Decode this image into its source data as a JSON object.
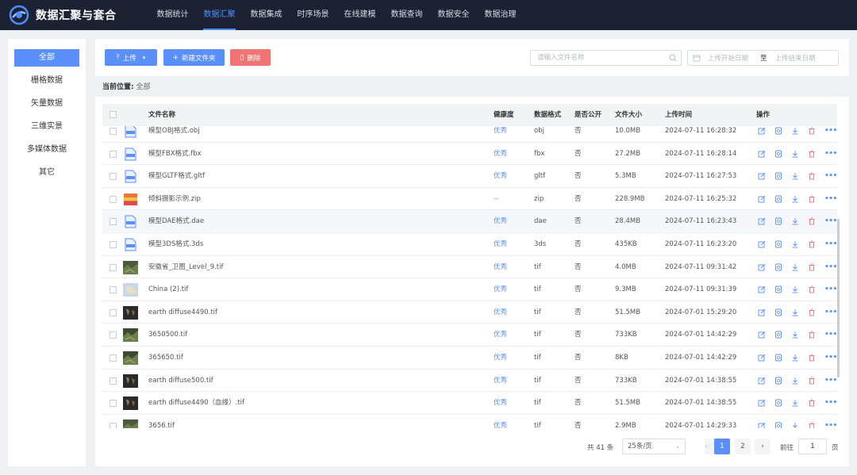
{
  "app": {
    "title": "数据汇聚与套合"
  },
  "nav": [
    {
      "label": "数据统计",
      "active": false
    },
    {
      "label": "数据汇聚",
      "active": true
    },
    {
      "label": "数据集成",
      "active": false
    },
    {
      "label": "时序场景",
      "active": false
    },
    {
      "label": "在线建模",
      "active": false
    },
    {
      "label": "数据查询",
      "active": false
    },
    {
      "label": "数据安全",
      "active": false
    },
    {
      "label": "数据治理",
      "active": false
    }
  ],
  "sidebar": {
    "items": [
      {
        "label": "全部",
        "active": true
      },
      {
        "label": "栅格数据",
        "active": false
      },
      {
        "label": "矢量数据",
        "active": false
      },
      {
        "label": "三维实景",
        "active": false
      },
      {
        "label": "多媒体数据",
        "active": false
      },
      {
        "label": "其它",
        "active": false
      }
    ]
  },
  "toolbar": {
    "upload_label": "上传",
    "new_folder_label": "新建文件夹",
    "delete_label": "删除",
    "search_placeholder": "请输入文件名称",
    "start_date_placeholder": "上传开始日期",
    "date_separator": "至",
    "end_date_placeholder": "上传结束日期"
  },
  "breadcrumb": {
    "label": "当前位置:",
    "value": "全部"
  },
  "table": {
    "columns": {
      "name": "文件名称",
      "health": "健康度",
      "format": "数据格式",
      "public": "是否公开",
      "size": "文件大小",
      "time": "上传时间",
      "ops": "操作"
    },
    "rows": [
      {
        "name": "模型OBJ格式.obj",
        "health": "优秀",
        "format": "obj",
        "public": "否",
        "size": "10.0MB",
        "time": "2024-07-11 16:28:32",
        "icon": "model-file-icon",
        "color": "#5b8ff9"
      },
      {
        "name": "模型FBX格式.fbx",
        "health": "优秀",
        "format": "fbx",
        "public": "否",
        "size": "27.2MB",
        "time": "2024-07-11 16:28:14",
        "icon": "model-file-icon",
        "color": "#5b8ff9"
      },
      {
        "name": "模型GLTF格式.gltf",
        "health": "优秀",
        "format": "gltf",
        "public": "否",
        "size": "5.3MB",
        "time": "2024-07-11 16:27:53",
        "icon": "model-file-icon",
        "color": "#5b8ff9"
      },
      {
        "name": "倾斜摄影示例.zip",
        "health": "--",
        "format": "zip",
        "public": "否",
        "size": "228.9MB",
        "time": "2024-07-11 16:25:32",
        "icon": "zip-file-icon",
        "color": "#e9773e"
      },
      {
        "name": "模型DAE格式.dae",
        "health": "优秀",
        "format": "dae",
        "public": "否",
        "size": "28.4MB",
        "time": "2024-07-11 16:23:43",
        "icon": "model-file-icon",
        "color": "#5b8ff9"
      },
      {
        "name": "模型3DS格式.3ds",
        "health": "优秀",
        "format": "3ds",
        "public": "否",
        "size": "435KB",
        "time": "2024-07-11 16:23:20",
        "icon": "model-file-icon",
        "color": "#5b8ff9"
      },
      {
        "name": "安徽省_卫图_Level_9.tif",
        "health": "优秀",
        "format": "tif",
        "public": "否",
        "size": "4.0MB",
        "time": "2024-07-11 09:31:42",
        "icon": "satellite-thumbnail-icon",
        "color": "#4a5b3a"
      },
      {
        "name": "China (2).tif",
        "health": "优秀",
        "format": "tif",
        "public": "否",
        "size": "9.3MB",
        "time": "2024-07-11 09:31:39",
        "icon": "map-thumbnail-icon",
        "color": "#c9d8e8"
      },
      {
        "name": "earth diffuse4490.tif",
        "health": "优秀",
        "format": "tif",
        "public": "否",
        "size": "51.5MB",
        "time": "2024-07-01 15:29:20",
        "icon": "earth-thumbnail-icon",
        "color": "#2a2a2a"
      },
      {
        "name": "3650500.tif",
        "health": "优秀",
        "format": "tif",
        "public": "否",
        "size": "733KB",
        "time": "2024-07-01 14:42:29",
        "icon": "satellite-thumbnail-icon",
        "color": "#3d4a30"
      },
      {
        "name": "365650.tif",
        "health": "优秀",
        "format": "tif",
        "public": "否",
        "size": "8KB",
        "time": "2024-07-01 14:42:29",
        "icon": "satellite-thumbnail-icon",
        "color": "#3d4a30"
      },
      {
        "name": "earth diffuse500.tif",
        "health": "优秀",
        "format": "tif",
        "public": "否",
        "size": "733KB",
        "time": "2024-07-01 14:38:55",
        "icon": "earth-thumbnail-icon",
        "color": "#2a2a2a"
      },
      {
        "name": "earth diffuse4490（血缘）.tif",
        "health": "优秀",
        "format": "tif",
        "public": "否",
        "size": "51.5MB",
        "time": "2024-07-01 14:38:55",
        "icon": "earth-thumbnail-icon",
        "color": "#2a2a2a"
      },
      {
        "name": "3656.tif",
        "health": "优秀",
        "format": "tif",
        "public": "否",
        "size": "2.9MB",
        "time": "2024-07-01 14:29:33",
        "icon": "satellite-thumbnail-icon",
        "color": "#4a5b3a"
      }
    ]
  },
  "pagination": {
    "total_label": "共 41 条",
    "page_size": "25条/页",
    "pages": [
      "1",
      "2"
    ],
    "current_page": "1",
    "goto_prefix": "前往",
    "goto_value": "1",
    "goto_suffix": "页"
  },
  "colors": {
    "accent": "#5b8ff9",
    "danger": "#f07474",
    "topbar": "#1d2233"
  }
}
